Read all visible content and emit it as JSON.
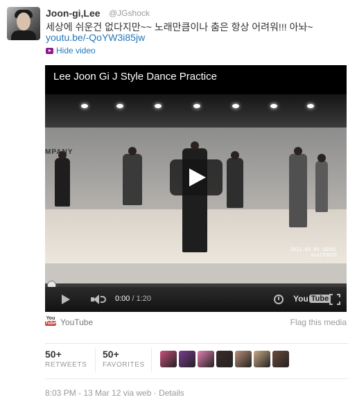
{
  "tweet": {
    "name": "Joon-gi,Lee",
    "handle": "@JGshock",
    "text": "세상에 쉬운건 없다지만~~ 노래만큼이나 춤은 항상 어려워!!! 아놔~",
    "link": "youtu.be/-QoYW3i85jw",
    "hide_video": "Hide video"
  },
  "video": {
    "title": "Lee Joon Gi J Style Dance Practice",
    "wall_text": "MPANY",
    "stamp_date": "2012.03.09",
    "stamp_place": "SEOUL",
    "stamp_studio": "xxxSTUDIO",
    "current_time": "0:00",
    "separator": "/",
    "duration": "1:20",
    "logo_you": "You",
    "logo_tube": "Tube",
    "progress": 0
  },
  "source": {
    "logo_you": "You",
    "logo_tube": "Tube",
    "label": "YouTube",
    "flag": "Flag this media"
  },
  "stats": {
    "retweets_count": "50+",
    "retweets_label": "RETWEETS",
    "favorites_count": "50+",
    "favorites_label": "FAVORITES"
  },
  "favoriters": [
    {
      "color": "#c84f7a",
      "icon": "rainbow-avatar"
    },
    {
      "color": "#7a3b8f",
      "icon": "purple-avatar"
    },
    {
      "color": "#e27fb0",
      "icon": "hello-kitty-avatar"
    },
    {
      "color": "#3d2b2b",
      "icon": "dark-avatar"
    },
    {
      "color": "#b98f78",
      "icon": "portrait-avatar"
    },
    {
      "color": "#caa987",
      "icon": "face-avatar"
    },
    {
      "color": "#6b4a3d",
      "icon": "group-avatar"
    }
  ],
  "meta": {
    "time": "8:03 PM - 13 Mar 12 via web",
    "sep": "·",
    "details": "Details"
  }
}
